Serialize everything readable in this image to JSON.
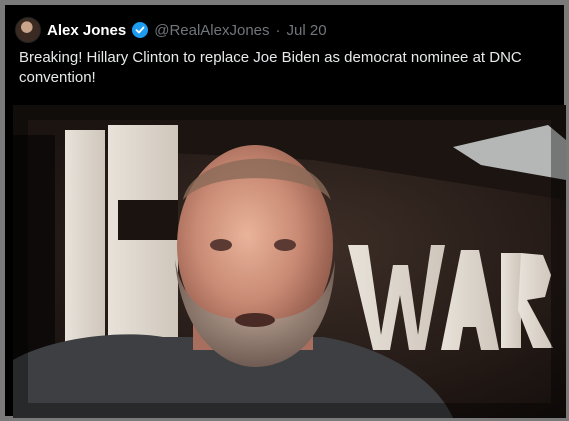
{
  "tweet": {
    "author_name": "Alex Jones",
    "handle": "@RealAlexJones",
    "separator": "·",
    "date": "Jul 20",
    "text": "Breaking! Hillary Clinton to replace Joe Biden as democrat nominee at DNC convention!"
  },
  "media": {
    "wall_lettering": "INFOWARS",
    "icons": [
      "verified-badge-icon"
    ],
    "colors": {
      "verified": "#1d9bf0",
      "background": "#000000",
      "text": "#e7e9ea",
      "muted": "#71767b"
    }
  }
}
